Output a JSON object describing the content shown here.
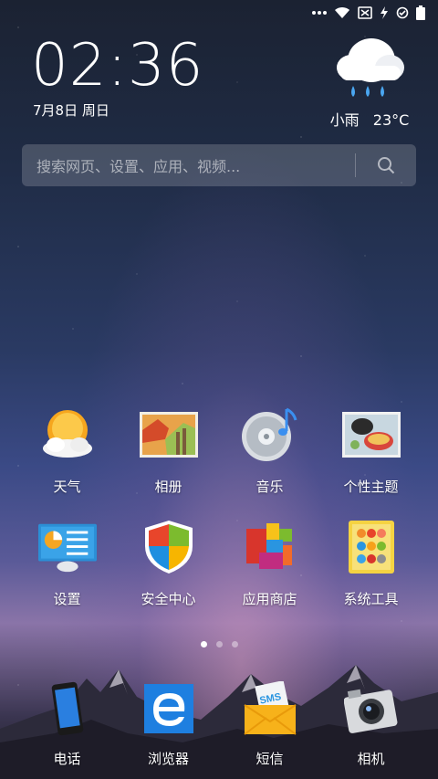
{
  "status_bar": {
    "icons": [
      "more-icon",
      "wifi-icon",
      "sim-off-icon",
      "charging-icon",
      "sync-icon",
      "battery-icon"
    ]
  },
  "clock": {
    "time": "02:36",
    "date": "7月8日 周日"
  },
  "weather": {
    "condition": "小雨",
    "temperature": "23°C",
    "icon": "cloud-rain-icon"
  },
  "search": {
    "placeholder": "搜索网页、设置、应用、视频..."
  },
  "apps": [
    {
      "label": "天气",
      "icon": "weather-app-icon"
    },
    {
      "label": "相册",
      "icon": "gallery-app-icon"
    },
    {
      "label": "音乐",
      "icon": "music-app-icon"
    },
    {
      "label": "个性主题",
      "icon": "themes-app-icon"
    },
    {
      "label": "设置",
      "icon": "settings-app-icon"
    },
    {
      "label": "安全中心",
      "icon": "security-app-icon"
    },
    {
      "label": "应用商店",
      "icon": "app-store-icon"
    },
    {
      "label": "系统工具",
      "icon": "system-tools-icon"
    }
  ],
  "pager": {
    "pages": 3,
    "current": 1
  },
  "dock": [
    {
      "label": "电话",
      "icon": "phone-app-icon"
    },
    {
      "label": "浏览器",
      "icon": "browser-app-icon"
    },
    {
      "label": "短信",
      "icon": "sms-app-icon"
    },
    {
      "label": "相机",
      "icon": "camera-app-icon"
    }
  ],
  "sms_badge_text": "SMS"
}
